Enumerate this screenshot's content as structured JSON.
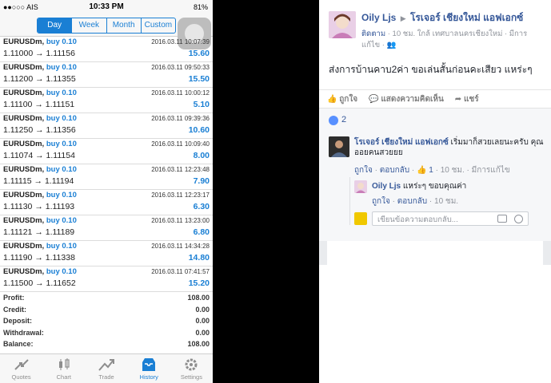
{
  "phone": {
    "status": {
      "carrier": "●●○○○ AIS",
      "time": "10:33 PM",
      "battery": "81%"
    },
    "segments": [
      {
        "label": "Day",
        "active": true
      },
      {
        "label": "Week",
        "active": false
      },
      {
        "label": "Month",
        "active": false
      },
      {
        "label": "Custom",
        "active": false
      }
    ],
    "trades": [
      {
        "symbol": "EURUSDm,",
        "action": "buy 0.10",
        "datetime": "2016.03.11 10:07:39",
        "prices": "1.11000 → 1.11156",
        "profit": "15.60"
      },
      {
        "symbol": "EURUSDm,",
        "action": "buy 0.10",
        "datetime": "2016.03.11 09:50:33",
        "prices": "1.11200 → 1.11355",
        "profit": "15.50"
      },
      {
        "symbol": "EURUSDm,",
        "action": "buy 0.10",
        "datetime": "2016.03.11 10:00:12",
        "prices": "1.11100 → 1.11151",
        "profit": "5.10"
      },
      {
        "symbol": "EURUSDm,",
        "action": "buy 0.10",
        "datetime": "2016.03.11 09:39:36",
        "prices": "1.11250 → 1.11356",
        "profit": "10.60"
      },
      {
        "symbol": "EURUSDm,",
        "action": "buy 0.10",
        "datetime": "2016.03.11 10:09:40",
        "prices": "1.11074 → 1.11154",
        "profit": "8.00"
      },
      {
        "symbol": "EURUSDm,",
        "action": "buy 0.10",
        "datetime": "2016.03.11 12:23:48",
        "prices": "1.11115 → 1.11194",
        "profit": "7.90"
      },
      {
        "symbol": "EURUSDm,",
        "action": "buy 0.10",
        "datetime": "2016.03.11 12:23:17",
        "prices": "1.11130 → 1.11193",
        "profit": "6.30"
      },
      {
        "symbol": "EURUSDm,",
        "action": "buy 0.10",
        "datetime": "2016.03.11 13:23:00",
        "prices": "1.11121 → 1.11189",
        "profit": "6.80"
      },
      {
        "symbol": "EURUSDm,",
        "action": "buy 0.10",
        "datetime": "2016.03.11 14:34:28",
        "prices": "1.11190 → 1.11338",
        "profit": "14.80"
      },
      {
        "symbol": "EURUSDm,",
        "action": "buy 0.10",
        "datetime": "2016.03.11 07:41:57",
        "prices": "1.11500 → 1.11652",
        "profit": "15.20"
      }
    ],
    "summary": [
      {
        "label": "Profit:",
        "value": "108.00"
      },
      {
        "label": "Credit:",
        "value": "0.00"
      },
      {
        "label": "Deposit:",
        "value": "0.00"
      },
      {
        "label": "Withdrawal:",
        "value": "0.00"
      },
      {
        "label": "Balance:",
        "value": "108.00"
      }
    ],
    "tabs": [
      {
        "label": "Quotes",
        "icon": "quotes-icon",
        "active": false
      },
      {
        "label": "Chart",
        "icon": "chart-icon",
        "active": false
      },
      {
        "label": "Trade",
        "icon": "trade-icon",
        "active": false
      },
      {
        "label": "History",
        "icon": "history-icon",
        "active": true
      },
      {
        "label": "Settings",
        "icon": "settings-icon",
        "active": false
      }
    ],
    "colors": {
      "accent": "#1a7fd4"
    }
  },
  "fb": {
    "post": {
      "author": "Oily Ljs",
      "target": "โรเจอร์ เชียงใหม่ แอฟเอกซ์",
      "follow": "ติดตาม",
      "meta": "· 10 ชม. ใกล้ เทศบาลนครเชียงใหม่ · มีการแก้ไข ·",
      "text": "ส่งการบ้านคาบ2ค่า ขอเล่นสั้นก่อนคะเสียว แหร่ะๆ",
      "actions": {
        "like": "ถูกใจ",
        "comment": "แสดงความคิดเห็น",
        "share": "แชร์"
      }
    },
    "reactions": {
      "count": "2"
    },
    "comment1": {
      "name": "โรเจอร์ เชียงใหม่ แอฟเอกซ์",
      "text": "เริ่มมาก็สวยเลยนะครับ คุณออยคนสวยยย",
      "like": "ถูกใจ",
      "reply": "ตอบกลับ",
      "likes": "1",
      "time": "· 10 ชม. ·",
      "edited": "มีการแก้ไข"
    },
    "comment2": {
      "name": "Oily Ljs",
      "text": "แหร่ะๆ ขอบคุณค่า",
      "like": "ถูกใจ",
      "reply": "ตอบกลับ",
      "time": "· 10 ชม."
    },
    "reply_placeholder": "เขียนข้อความตอบกลับ...",
    "colors": {
      "link": "#365899",
      "muted": "#90949c"
    }
  }
}
